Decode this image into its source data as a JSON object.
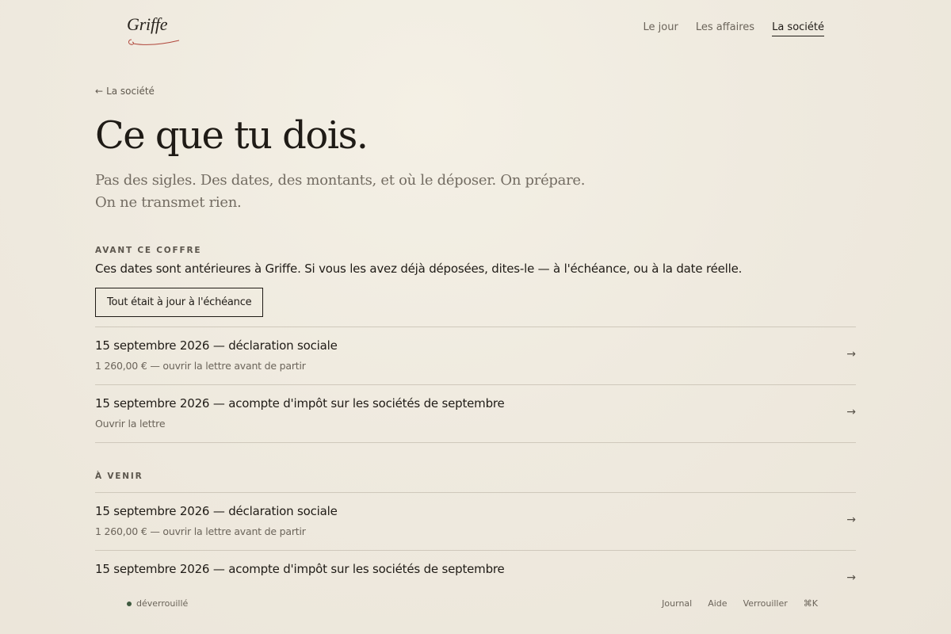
{
  "brand": {
    "name": "Griffe",
    "accent_color": "#b0463b"
  },
  "nav": {
    "items": [
      {
        "label": "Le jour",
        "active": false
      },
      {
        "label": "Les affaires",
        "active": false
      },
      {
        "label": "La société",
        "active": true
      }
    ]
  },
  "back": {
    "label": "La société",
    "icon": "arrow-left-icon"
  },
  "page": {
    "title": "Ce que tu dois.",
    "subtitle_line1": "Pas des sigles. Des dates, des montants, et où le déposer. On prépare.",
    "subtitle_line2": "On ne transmet rien."
  },
  "before_section": {
    "label": "AVANT CE COFFRE",
    "description": "Ces dates sont antérieures à Griffe. Si vous les avez déjà déposées, dites-le — à l'échéance, ou à la date réelle.",
    "button_label": "Tout était à jour à l'échéance",
    "items": [
      {
        "title": "15 septembre 2026 — déclaration sociale",
        "sub": "1 260,00 € — ouvrir la lettre avant de partir"
      },
      {
        "title": "15 septembre 2026 — acompte d'impôt sur les sociétés de septembre",
        "sub": "Ouvrir la lettre"
      }
    ]
  },
  "upcoming_section": {
    "label": "À VENIR",
    "items": [
      {
        "title": "15 septembre 2026 — déclaration sociale",
        "sub": "1 260,00 € — ouvrir la lettre avant de partir"
      },
      {
        "title": "15 septembre 2026 — acompte d'impôt sur les sociétés de septembre",
        "sub": ""
      }
    ]
  },
  "footer": {
    "status": "déverrouillé",
    "status_color": "#3f5a3f",
    "links": [
      "Journal",
      "Aide",
      "Verrouiller",
      "⌘K"
    ]
  }
}
